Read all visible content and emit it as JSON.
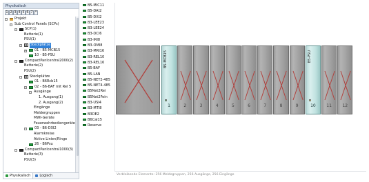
{
  "panel": {
    "title": "Physikalisch",
    "level_buttons": [
      "1",
      "2",
      "3",
      "4",
      "5",
      "6",
      "7",
      "*"
    ]
  },
  "tree": [
    {
      "label": "Projekt",
      "icon": "house",
      "indent": 0,
      "toggle": "-"
    },
    {
      "label": "Sub Control Panels (SCPs)",
      "icon": "",
      "indent": 1,
      "toggle": "-"
    },
    {
      "label": "SCP(1)",
      "icon": "rack",
      "indent": 2,
      "toggle": "-"
    },
    {
      "label": "Batterie(1)",
      "icon": "",
      "indent": 3,
      "toggle": ""
    },
    {
      "label": "PSU(1)",
      "icon": "",
      "indent": 3,
      "toggle": ""
    },
    {
      "label": "Steckplätze",
      "icon": "grid",
      "indent": 3,
      "toggle": "-",
      "selected": true
    },
    {
      "label": "01 - B5-MCB15",
      "icon": "modgreen",
      "indent": 4,
      "toggle": "+"
    },
    {
      "label": "10 - B5-PSU",
      "icon": "modgreen",
      "indent": 4,
      "toggle": ""
    },
    {
      "label": "CompactPanlcentral2000(2)",
      "icon": "rack",
      "indent": 2,
      "toggle": "-"
    },
    {
      "label": "Batterie(2)",
      "icon": "",
      "indent": 3,
      "toggle": ""
    },
    {
      "label": "PSU(2)",
      "icon": "",
      "indent": 3,
      "toggle": ""
    },
    {
      "label": "Steckplätze",
      "icon": "grid",
      "indent": 3,
      "toggle": "-"
    },
    {
      "label": "01 - B6Rcb15",
      "icon": "modgreen",
      "indent": 4,
      "toggle": ""
    },
    {
      "label": "02 - B6-BAF mit Rel 5",
      "icon": "modgreen",
      "indent": 4,
      "toggle": "-"
    },
    {
      "label": "Ausgänge",
      "icon": "",
      "indent": 5,
      "toggle": "-"
    },
    {
      "label": "1. Ausgang(1)",
      "icon": "",
      "indent": 6,
      "toggle": ""
    },
    {
      "label": "2. Ausgang(2)",
      "icon": "",
      "indent": 6,
      "toggle": ""
    },
    {
      "label": "Eingänge",
      "icon": "",
      "indent": 5,
      "toggle": ""
    },
    {
      "label": "Meldergruppen",
      "icon": "",
      "indent": 5,
      "toggle": ""
    },
    {
      "label": "MWI-Geräte",
      "icon": "",
      "indent": 5,
      "toggle": ""
    },
    {
      "label": "Feuerwehrbediengeräte",
      "icon": "",
      "indent": 5,
      "toggle": ""
    },
    {
      "label": "03 - B6-DXI2",
      "icon": "modgreen",
      "indent": 4,
      "toggle": "-"
    },
    {
      "label": "Alarmkreise",
      "icon": "",
      "indent": 5,
      "toggle": ""
    },
    {
      "label": "Aktive Linien/Ringe",
      "icon": "",
      "indent": 5,
      "toggle": ""
    },
    {
      "label": "26 - B6Psu",
      "icon": "modgreen",
      "indent": 4,
      "toggle": ""
    },
    {
      "label": "CompactPanlcentral1000(3)",
      "icon": "rack",
      "indent": 2,
      "toggle": "-"
    },
    {
      "label": "Batterie(3)",
      "icon": "",
      "indent": 3,
      "toggle": ""
    },
    {
      "label": "PSU(3)",
      "icon": "",
      "indent": 3,
      "toggle": ""
    }
  ],
  "tabs": [
    {
      "label": "Physikalisch",
      "color": "#2b9a3f"
    },
    {
      "label": "Logisch",
      "color": "#3a79c7"
    }
  ],
  "modules": [
    "B5-MIC11",
    "B5-DAI2",
    "B5-DXI2",
    "B3-LEE23",
    "B3-LEE24",
    "B3-DCI6",
    "B3-IRI8",
    "B3-OMI8",
    "B3-MRI16",
    "B3-REL10",
    "B3-REL16",
    "B5-BAF",
    "B5-LAN",
    "B5-NET2-485",
    "B5-NET4-485",
    "B5Net2Rei",
    "B5Net2Fein",
    "B3-USI4",
    "B3-MTI8",
    "B3DE2",
    "B6Cal15",
    "Reserve"
  ],
  "rack": {
    "slots": [
      {
        "num": "1",
        "name": "B5-MCB15",
        "occupied": true,
        "led": "on",
        "cross": false
      },
      {
        "num": "2",
        "name": "",
        "occupied": false,
        "led": "",
        "cross": true
      },
      {
        "num": "3",
        "name": "",
        "occupied": false,
        "led": "",
        "cross": true
      },
      {
        "num": "4",
        "name": "",
        "occupied": false,
        "led": "",
        "cross": true
      },
      {
        "num": "5",
        "name": "",
        "occupied": false,
        "led": "",
        "cross": true
      },
      {
        "num": "6",
        "name": "",
        "occupied": false,
        "led": "",
        "cross": true
      },
      {
        "num": "7",
        "name": "",
        "occupied": false,
        "led": "",
        "cross": true
      },
      {
        "num": "8",
        "name": "",
        "occupied": false,
        "led": "",
        "cross": true
      },
      {
        "num": "9",
        "name": "",
        "occupied": false,
        "led": "",
        "cross": true
      },
      {
        "num": "10",
        "name": "B5-PSU",
        "occupied": true,
        "led": "warn",
        "cross": false
      },
      {
        "num": "11",
        "name": "",
        "occupied": false,
        "led": "",
        "cross": true
      },
      {
        "num": "12",
        "name": "",
        "occupied": false,
        "led": "",
        "cross": true
      }
    ],
    "cross_color": "#b0413d",
    "occupied_color": "#c8e6e4"
  },
  "status": "Verbleibende Elemente: 256 Meldegruppen, 256 Ausgänge, 256 Eingänge"
}
